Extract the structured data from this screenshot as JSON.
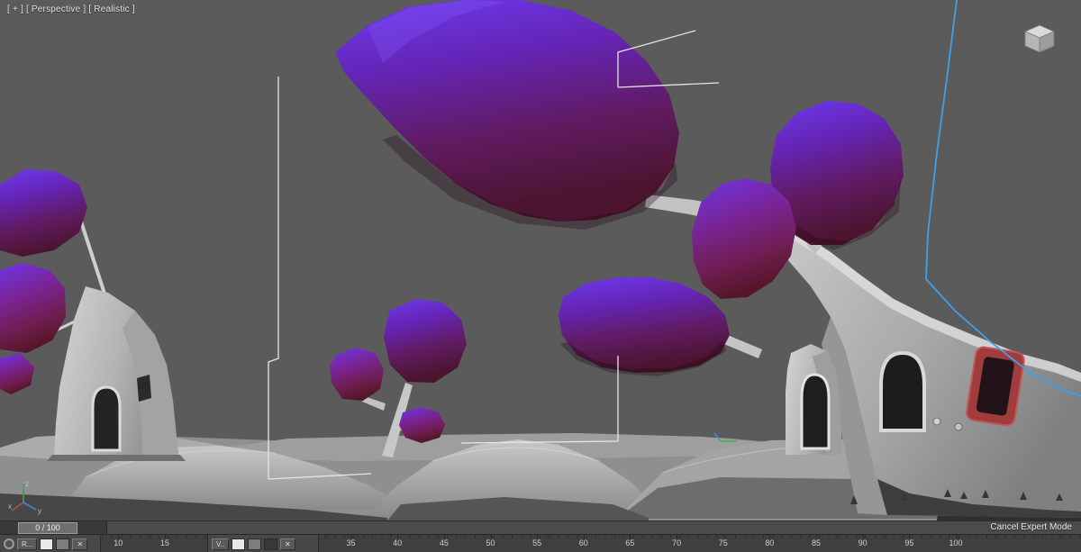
{
  "viewport": {
    "label_plus": "[ + ]",
    "label_view": "[ Perspective ]",
    "label_shading": "[ Realistic ]",
    "axis": {
      "x": "x",
      "y": "y",
      "z": "z"
    }
  },
  "timeline": {
    "slider_value": "0 / 100",
    "ticks": [
      "10",
      "15",
      "35",
      "40",
      "45",
      "50",
      "55",
      "60",
      "65",
      "70",
      "75",
      "80",
      "85",
      "90",
      "95",
      "100"
    ]
  },
  "statusbar": {
    "left": {
      "button": "R...",
      "close": "✕"
    },
    "center": {
      "button": "V..",
      "close": "✕"
    },
    "cancel_expert": "Cancel Expert Mode"
  },
  "colors": {
    "foliage_top": "#6d3af0",
    "foliage_bottom": "#4c142f",
    "trunk_light": "#d2d2d2",
    "door_red": "#a03c3c",
    "spline_blue": "#3f9fe8",
    "viewport_bg": "#5b5b5b"
  }
}
